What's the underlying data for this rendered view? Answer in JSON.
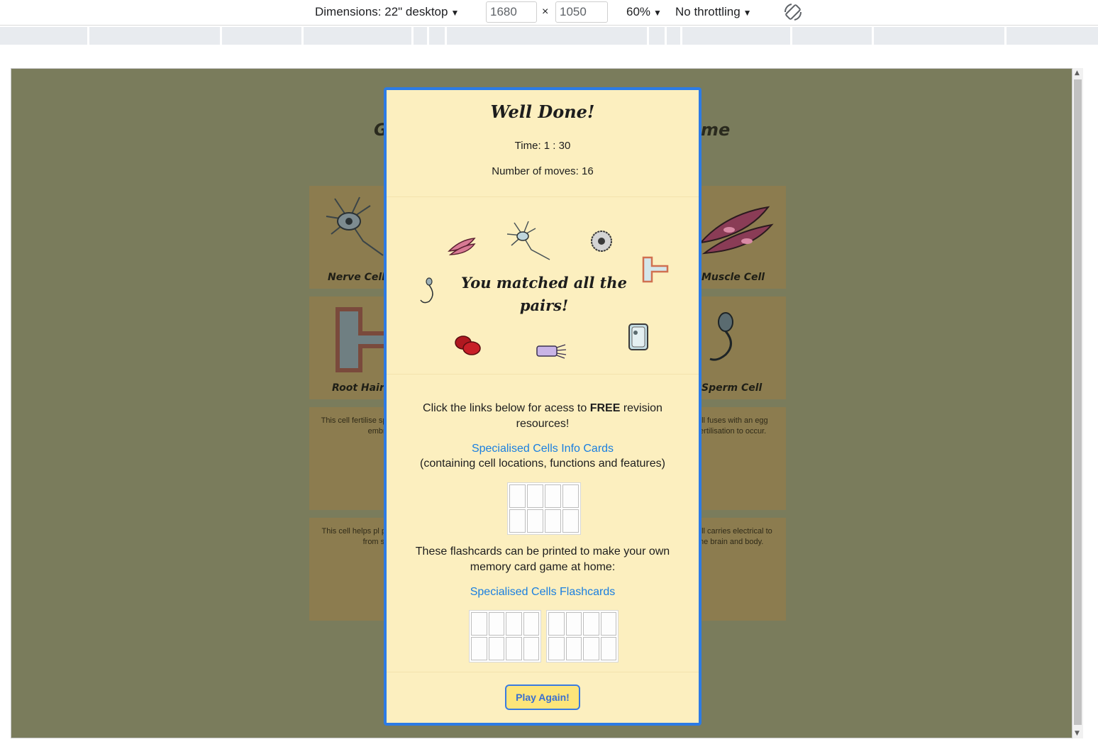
{
  "devtools": {
    "dimensions_label": "Dimensions: 22\" desktop",
    "width": "1680",
    "times": "×",
    "height": "1050",
    "zoom": "60%",
    "throttling": "No throttling",
    "caret": "▼"
  },
  "background_page": {
    "title_left": "G",
    "title_right": "me",
    "cards": [
      {
        "label": "Nerve Cell",
        "icon": "nerve-cell-icon"
      },
      {
        "label": "Muscle Cell",
        "icon": "muscle-cell-icon"
      },
      {
        "label": "Root Hair",
        "icon": "root-hair-cell-icon"
      },
      {
        "label": "Sperm Cell",
        "icon": "sperm-cell-icon"
      },
      {
        "text": "This cell fertilise sperm then develo embryo."
      },
      {
        "text": "ell fuses with an egg fertilisation to occur."
      },
      {
        "text": "This cell helps pl photosynthesis to from sunlig"
      },
      {
        "text": "ell carries electrical to the brain and body."
      }
    ]
  },
  "modal": {
    "title": "Well Done!",
    "time": "Time: 1 : 30",
    "moves": "Number of moves: 16",
    "matched": "You matched all the pairs!",
    "intro_pre": "Click the links below for acess to ",
    "intro_bold": "FREE",
    "intro_post": " revision resources!",
    "info_link": "Specialised Cells Info Cards",
    "info_note": "(containing cell locations, functions and features)",
    "flash_text": "These flashcards can be printed to make your own memory card game at home:",
    "flash_link": "Specialised Cells Flashcards",
    "play_again": "Play Again!"
  },
  "colors": {
    "page_bg": "#7a7c5c",
    "card_bg": "#8c7c4f",
    "modal_bg": "#fcefbf",
    "modal_border": "#2c7be5",
    "link": "#1a7fe0",
    "button_bg": "#fde57a"
  }
}
